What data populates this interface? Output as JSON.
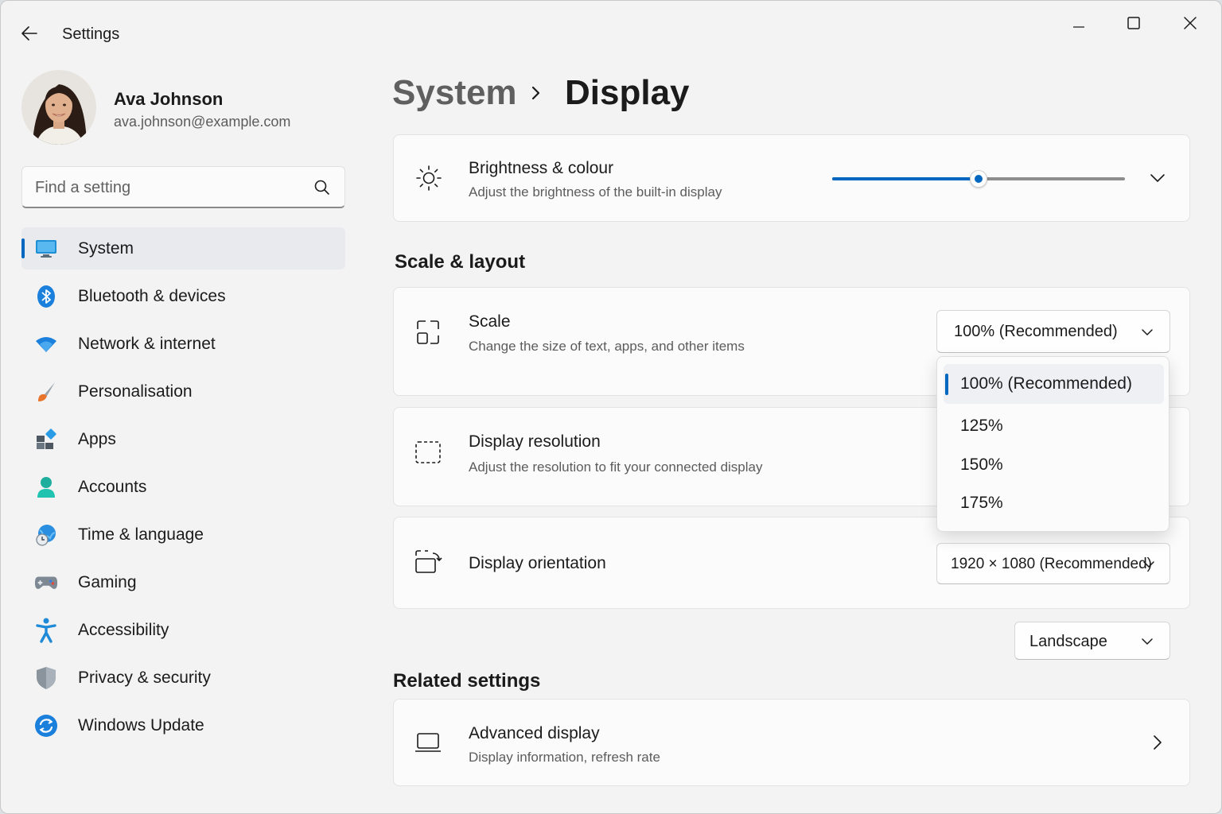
{
  "app": {
    "title": "Settings"
  },
  "profile": {
    "name": "Ava Johnson",
    "email": "ava.johnson@example.com"
  },
  "search": {
    "placeholder": "Find a setting"
  },
  "sidebar": {
    "items": [
      {
        "label": "System",
        "icon": "monitor-icon",
        "active": true
      },
      {
        "label": "Bluetooth & devices",
        "icon": "bluetooth-icon"
      },
      {
        "label": "Network & internet",
        "icon": "wifi-icon"
      },
      {
        "label": "Personalisation",
        "icon": "paintbrush-icon"
      },
      {
        "label": "Apps",
        "icon": "apps-icon"
      },
      {
        "label": "Accounts",
        "icon": "person-icon"
      },
      {
        "label": "Time & language",
        "icon": "globe-clock-icon"
      },
      {
        "label": "Gaming",
        "icon": "gamepad-icon"
      },
      {
        "label": "Accessibility",
        "icon": "accessibility-icon"
      },
      {
        "label": "Privacy & security",
        "icon": "shield-icon"
      },
      {
        "label": "Windows Update",
        "icon": "update-icon"
      }
    ]
  },
  "breadcrumb": {
    "parent": "System",
    "current": "Display"
  },
  "brightness": {
    "title": "Brightness & colour",
    "subtitle": "Adjust the brightness of the built-in display",
    "level": 0.5
  },
  "scale_layout": {
    "heading": "Scale & layout",
    "scale": {
      "title": "Scale",
      "subtitle": "Change the size of text, apps, and other items",
      "value": "100% (Recommended)",
      "options": [
        "100% (Recommended)",
        "125%",
        "150%",
        "175%"
      ],
      "selected_index": 0
    },
    "resolution": {
      "title": "Display resolution",
      "subtitle": "Adjust the resolution to fit your connected display",
      "value": "1920 × 1080 (Recommended)"
    },
    "orientation": {
      "title": "Display orientation",
      "value": "Landscape"
    }
  },
  "related": {
    "heading": "Related settings",
    "advanced": {
      "title": "Advanced display",
      "subtitle": "Display information, refresh rate"
    }
  },
  "colors": {
    "accent": "#0067c0",
    "background": "#f3f3f3",
    "card": "#fbfbfb"
  }
}
